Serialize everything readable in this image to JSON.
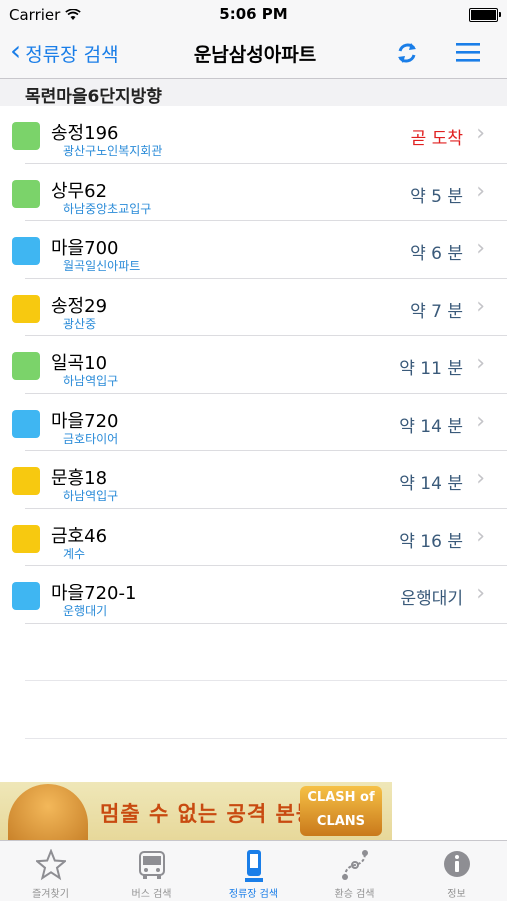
{
  "status_bar": {
    "carrier": "Carrier",
    "time": "5:06 PM"
  },
  "nav": {
    "back_label": "정류장 검색",
    "title": "운남삼성아파트"
  },
  "section": {
    "title": "목련마을6단지방향"
  },
  "routes": [
    {
      "name": "송정196",
      "stop": "광산구노인복지회관",
      "eta": "곧 도착",
      "color": "#7bd36a",
      "eta_color": "#e02020"
    },
    {
      "name": "상무62",
      "stop": "하남중앙초교입구",
      "eta": "약 5 분",
      "color": "#7bd36a"
    },
    {
      "name": "마을700",
      "stop": "월곡일신아파트",
      "eta": "약 6 분",
      "color": "#3fb6f2"
    },
    {
      "name": "송정29",
      "stop": "광산중",
      "eta": "약 7 분",
      "color": "#f7c910"
    },
    {
      "name": "일곡10",
      "stop": "하남역입구",
      "eta": "약 11 분",
      "color": "#7bd36a"
    },
    {
      "name": "마을720",
      "stop": "금호타이어",
      "eta": "약 14 분",
      "color": "#3fb6f2"
    },
    {
      "name": "문흥18",
      "stop": "하남역입구",
      "eta": "약 14 분",
      "color": "#f7c910"
    },
    {
      "name": "금호46",
      "stop": "계수",
      "eta": "약 16 분",
      "color": "#f7c910"
    },
    {
      "name": "마을720-1",
      "stop": "운행대기",
      "eta": "운행대기",
      "color": "#3fb6f2"
    }
  ],
  "ad": {
    "text": "멈출 수 없는 공격 본능!",
    "logo": "CLASH of CLANS"
  },
  "tabs": [
    {
      "label": "즐겨찾기",
      "icon": "star-icon"
    },
    {
      "label": "버스 검색",
      "icon": "bus-icon"
    },
    {
      "label": "정류장 검색",
      "icon": "bus-stop-icon",
      "active": true
    },
    {
      "label": "환승 검색",
      "icon": "transfer-route-icon"
    },
    {
      "label": "정보",
      "icon": "info-icon"
    }
  ],
  "colors": {
    "accent": "#1a7ee8",
    "arrival_soon": "#e02020"
  }
}
